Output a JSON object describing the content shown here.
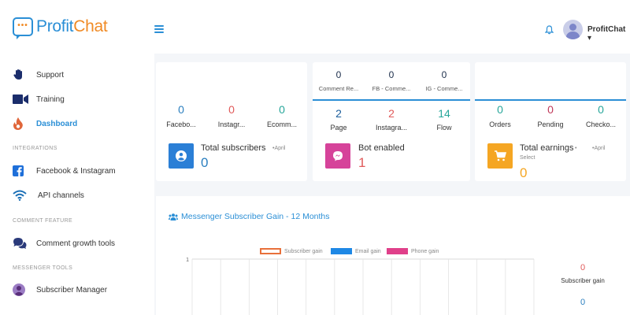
{
  "brand": {
    "name_part1": "Profit",
    "name_part2": "Chat",
    "dots": "•••"
  },
  "header": {
    "user_name": "ProfitChat ▾"
  },
  "sidebar": {
    "items": [
      {
        "label": "Support",
        "icon": "hand-icon"
      },
      {
        "label": "Training",
        "icon": "video-camera-icon"
      },
      {
        "label": "Dashboard",
        "icon": "fire-icon",
        "active": true
      }
    ],
    "sections": [
      {
        "title": "INTEGRATIONS",
        "items": [
          {
            "label": "Facebook & Instagram",
            "icon": "facebook-icon"
          },
          {
            "label": "API channels",
            "icon": "wifi-icon"
          }
        ]
      },
      {
        "title": "COMMENT FEATURE",
        "items": [
          {
            "label": "Comment growth tools",
            "icon": "chat-bubbles-icon"
          }
        ]
      },
      {
        "title": "MESSENGER TOOLS",
        "items": [
          {
            "label": "Subscriber Manager",
            "icon": "user-circle-icon"
          }
        ]
      }
    ]
  },
  "cards": {
    "subscribers": {
      "stats": [
        {
          "value": "0",
          "label": "Facebo...",
          "color": "#2b7fbf"
        },
        {
          "value": "0",
          "label": "Instagr...",
          "color": "#e05a5a"
        },
        {
          "value": "0",
          "label": "Ecomm...",
          "color": "#27a69a"
        }
      ],
      "title": "Total subscribers",
      "period": "•April",
      "value": "0",
      "icon_color": "#2b7fd6"
    },
    "bots": {
      "top_stats": [
        {
          "value": "0",
          "label": "Comment Re..."
        },
        {
          "value": "0",
          "label": "FB - Comme..."
        },
        {
          "value": "0",
          "label": "IG - Comme..."
        }
      ],
      "stats": [
        {
          "value": "2",
          "label": "Page",
          "color": "#2b7fbf"
        },
        {
          "value": "2",
          "label": "Instagra...",
          "color": "#e05a5a"
        },
        {
          "value": "14",
          "label": "Flow",
          "color": "#27a69a"
        }
      ],
      "title": "Bot enabled",
      "value": "1",
      "icon_color": "#d6439a"
    },
    "earnings": {
      "stats": [
        {
          "value": "0",
          "label": "Orders",
          "color": "#27a69a"
        },
        {
          "value": "0",
          "label": "Pending",
          "color": "#c0395a"
        },
        {
          "value": "0",
          "label": "Checko...",
          "color": "#27a69a"
        }
      ],
      "title": "Total earnings",
      "title_suffix": "•",
      "select": "Select",
      "period": "•April",
      "value": "0",
      "icon_color": "#f5a623"
    }
  },
  "chart": {
    "title": "Messenger Subscriber Gain - 12 Months",
    "legend": [
      {
        "name": "Subscriber gain",
        "color": "#e8703a"
      },
      {
        "name": "Email gain",
        "color": "#1e88e5"
      },
      {
        "name": "Phone gain",
        "color": "#e0408a"
      }
    ],
    "y_tick": "1",
    "side_value": "0",
    "side_label": "Subscriber gain",
    "side_value2": "0"
  },
  "chart_data": {
    "type": "line",
    "title": "Messenger Subscriber Gain - 12 Months",
    "series": [
      {
        "name": "Subscriber gain",
        "values": []
      },
      {
        "name": "Email gain",
        "values": []
      },
      {
        "name": "Phone gain",
        "values": []
      }
    ],
    "ylim": [
      0,
      1
    ],
    "grid": true,
    "legend": "top"
  }
}
